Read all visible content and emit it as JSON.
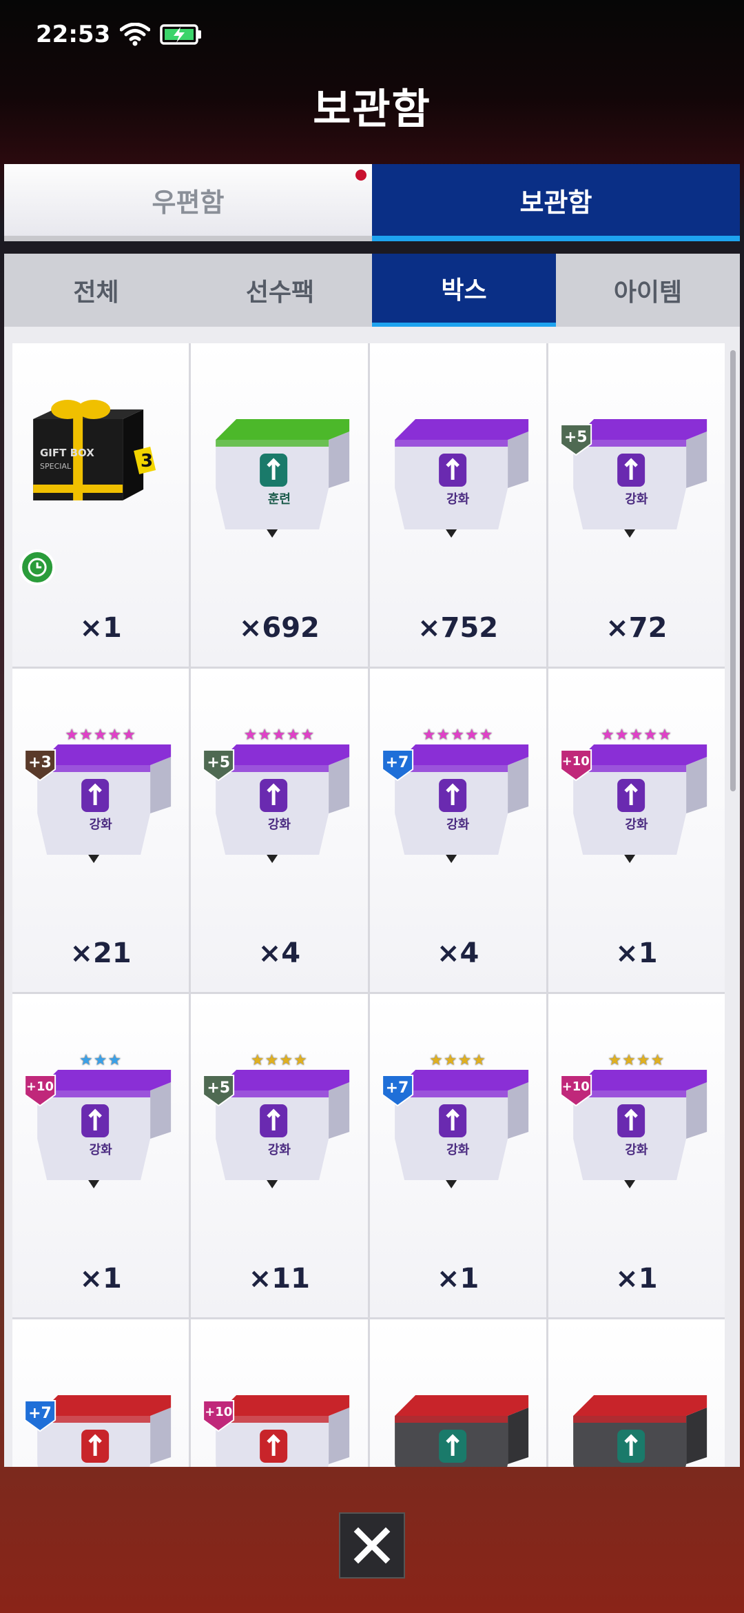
{
  "status": {
    "time": "22:53"
  },
  "header": {
    "title": "보관함"
  },
  "main_tabs": [
    {
      "label": "우편함",
      "active": false,
      "notification": true
    },
    {
      "label": "보관함",
      "active": true
    }
  ],
  "sub_tabs": [
    {
      "label": "전체",
      "active": false
    },
    {
      "label": "선수팩",
      "active": false
    },
    {
      "label": "박스",
      "active": true
    },
    {
      "label": "아이템",
      "active": false
    }
  ],
  "items": [
    {
      "kind": "gift",
      "lid": "#f0c000",
      "label": "",
      "badge": "",
      "badge_color": "",
      "stars": "",
      "star_color": "",
      "qty": "×1",
      "gift_text": "GIFT BOX",
      "gift_sub": "SPECIAL",
      "tag": "3",
      "timer": true
    },
    {
      "kind": "box",
      "lid": "#4cb82a",
      "label": "훈련",
      "emblem": "train",
      "badge": "",
      "badge_color": "",
      "stars": "",
      "star_color": "",
      "qty": "×692"
    },
    {
      "kind": "box",
      "lid": "#8a2fd6",
      "label": "강화",
      "emblem": "up",
      "badge": "",
      "badge_color": "",
      "stars": "",
      "star_color": "",
      "qty": "×752"
    },
    {
      "kind": "box",
      "lid": "#8a2fd6",
      "label": "강화",
      "emblem": "up",
      "badge": "+5",
      "badge_color": "#4f6a52",
      "stars": "",
      "star_color": "",
      "qty": "×72"
    },
    {
      "kind": "box",
      "lid": "#8a2fd6",
      "label": "강화",
      "emblem": "up",
      "badge": "+3",
      "badge_color": "#5a3a2a",
      "stars": "★★★★★",
      "star_color": "#e040c8",
      "qty": "×21"
    },
    {
      "kind": "box",
      "lid": "#8a2fd6",
      "label": "강화",
      "emblem": "up",
      "badge": "+5",
      "badge_color": "#4f6a52",
      "stars": "★★★★★",
      "star_color": "#e040c8",
      "qty": "×4"
    },
    {
      "kind": "box",
      "lid": "#8a2fd6",
      "label": "강화",
      "emblem": "up",
      "badge": "+7",
      "badge_color": "#1f6fd8",
      "stars": "★★★★★",
      "star_color": "#e040c8",
      "qty": "×4"
    },
    {
      "kind": "box",
      "lid": "#8a2fd6",
      "label": "강화",
      "emblem": "up",
      "badge": "+10",
      "badge_color": "#c0287a",
      "stars": "★★★★★",
      "star_color": "#e040c8",
      "qty": "×1"
    },
    {
      "kind": "box",
      "lid": "#8a2fd6",
      "label": "강화",
      "emblem": "up",
      "badge": "+10",
      "badge_color": "#c0287a",
      "stars": "★★★",
      "star_color": "#3aa0e8",
      "qty": "×1"
    },
    {
      "kind": "box",
      "lid": "#8a2fd6",
      "label": "강화",
      "emblem": "up",
      "badge": "+5",
      "badge_color": "#4f6a52",
      "stars": "★★★★",
      "star_color": "#e0b020",
      "qty": "×11"
    },
    {
      "kind": "box",
      "lid": "#8a2fd6",
      "label": "강화",
      "emblem": "up",
      "badge": "+7",
      "badge_color": "#1f6fd8",
      "stars": "★★★★",
      "star_color": "#e0b020",
      "qty": "×1"
    },
    {
      "kind": "box",
      "lid": "#8a2fd6",
      "label": "강화",
      "emblem": "up",
      "badge": "+10",
      "badge_color": "#c0287a",
      "stars": "★★★★",
      "star_color": "#e0b020",
      "qty": "×1"
    },
    {
      "kind": "box",
      "lid": "#c8242a",
      "label": "",
      "emblem": "up-red",
      "badge": "+7",
      "badge_color": "#1f6fd8",
      "stars": "",
      "star_color": "",
      "qty": ""
    },
    {
      "kind": "box",
      "lid": "#c8242a",
      "label": "",
      "emblem": "up-red",
      "badge": "+10",
      "badge_color": "#c0287a",
      "stars": "",
      "star_color": "",
      "qty": ""
    },
    {
      "kind": "box-dark",
      "lid": "#c8242a",
      "label": "",
      "emblem": "train",
      "badge": "",
      "badge_color": "",
      "stars": "",
      "star_color": "",
      "qty": ""
    },
    {
      "kind": "box-dark",
      "lid": "#c8242a",
      "label": "",
      "emblem": "train",
      "badge": "",
      "badge_color": "",
      "stars": "",
      "star_color": "",
      "qty": ""
    }
  ],
  "colors": {
    "tab_active": "#0a2f86",
    "tab_underline": "#1ea3ef",
    "qty_text": "#1d2240"
  },
  "icons": {
    "wifi": "wifi-icon",
    "battery": "battery-charging-icon",
    "close": "close-icon",
    "timer": "clock-icon"
  }
}
